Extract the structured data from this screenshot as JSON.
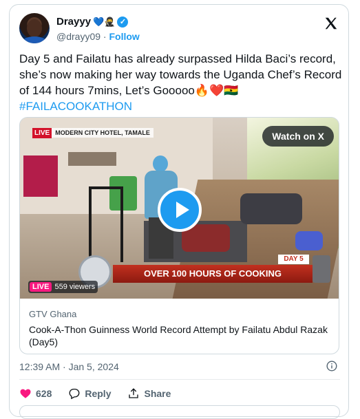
{
  "author": {
    "display_name": "Drayyy",
    "name_emojis": "💙🥷",
    "handle": "@drayy09",
    "separator": "·",
    "follow_label": "Follow"
  },
  "tweet": {
    "text": "Day 5 and Failatu has already surpassed Hilda Baci’s record, she’s now making her way towards the Uganda Chef’s Record of 144 hours 7mins, Let’s Gooooo🔥❤️🇬🇭",
    "hashtag": "#FAILACOOKATHON"
  },
  "media": {
    "live_label": "LIVE",
    "location": "MODERN CITY HOTEL, TAMALE",
    "watch_label": "Watch on X",
    "banner_text": "OVER 100 HOURS OF COOKING",
    "day_label": "DAY 5",
    "viewers_live": "LIVE",
    "viewers_count": "559 viewers",
    "source": "GTV Ghana",
    "title": "Cook-A-Thon Guinness World Record Attempt by Failatu Abdul Razak (Day5)"
  },
  "timestamp": "12:39 AM · Jan 5, 2024",
  "actions": {
    "like_count": "628",
    "reply_label": "Reply",
    "share_label": "Share"
  },
  "colors": {
    "accent": "#1d9bf0",
    "like": "#f91880",
    "text": "#0f1419",
    "muted": "#536471"
  },
  "icons": [
    "verified-icon",
    "x-logo-icon",
    "play-icon",
    "info-icon",
    "heart-icon",
    "reply-icon",
    "share-icon"
  ]
}
